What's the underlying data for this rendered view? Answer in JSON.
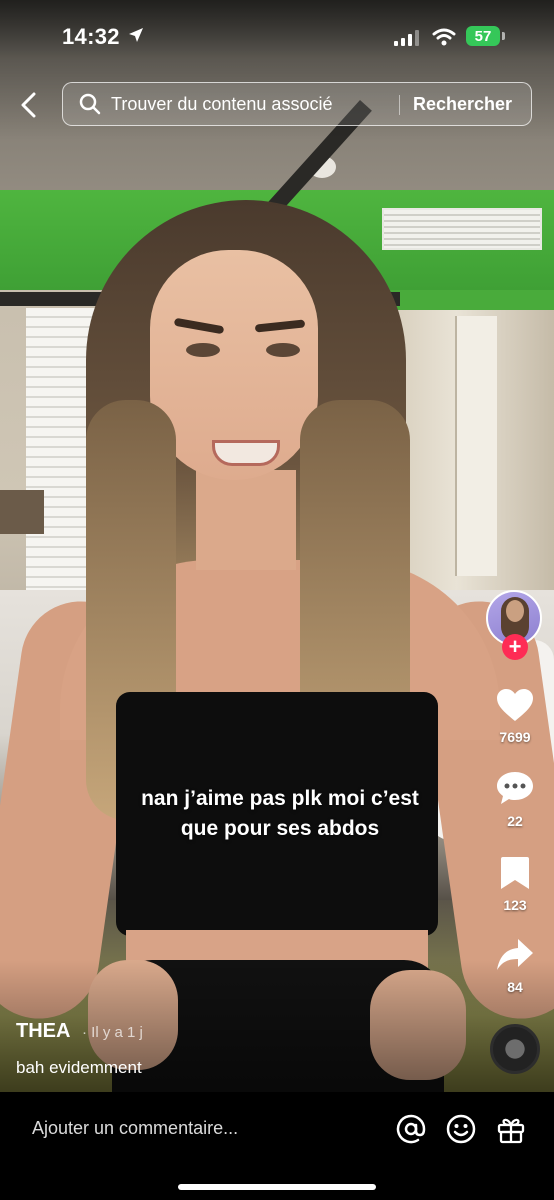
{
  "status_bar": {
    "time": "14:32",
    "battery": "57"
  },
  "search": {
    "placeholder": "Trouver du contenu associé",
    "button_label": "Rechercher"
  },
  "video": {
    "caption_line1": "nan j’aime pas plk moi c’est",
    "caption_line2": "que pour ses abdos"
  },
  "actions": {
    "likes": "7699",
    "comments": "22",
    "saves": "123",
    "shares": "84"
  },
  "post": {
    "author": "THEA",
    "time_ago": "· Il y a 1 j",
    "description": "bah evidemment"
  },
  "comment_bar": {
    "placeholder": "Ajouter un commentaire..."
  },
  "colors": {
    "follow": "#fe2c55",
    "battery": "#35c759"
  },
  "icons": [
    "back-icon",
    "search-icon",
    "heart-icon",
    "comment-icon",
    "bookmark-icon",
    "share-icon",
    "at-icon",
    "emoji-icon",
    "gift-icon",
    "location-arrow-icon",
    "signal-icon",
    "wifi-icon"
  ]
}
